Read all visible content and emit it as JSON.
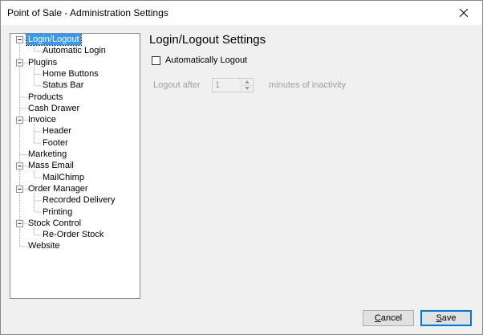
{
  "window": {
    "title": "Point of Sale - Administration Settings"
  },
  "tree": {
    "nodes": [
      {
        "label": "Login/Logout",
        "level": 0,
        "expander": "minus",
        "selected": true
      },
      {
        "label": "Automatic Login",
        "level": 1
      },
      {
        "label": "Plugins",
        "level": 0,
        "expander": "minus"
      },
      {
        "label": "Home Buttons",
        "level": 1
      },
      {
        "label": "Status Bar",
        "level": 1
      },
      {
        "label": "Products",
        "level": 0
      },
      {
        "label": "Cash Drawer",
        "level": 0
      },
      {
        "label": "Invoice",
        "level": 0,
        "expander": "minus"
      },
      {
        "label": "Header",
        "level": 1
      },
      {
        "label": "Footer",
        "level": 1
      },
      {
        "label": "Marketing",
        "level": 0
      },
      {
        "label": "Mass Email",
        "level": 0,
        "expander": "minus"
      },
      {
        "label": "MailChimp",
        "level": 1
      },
      {
        "label": "Order Manager",
        "level": 0,
        "expander": "minus"
      },
      {
        "label": "Recorded Delivery",
        "level": 1
      },
      {
        "label": "Printing",
        "level": 1
      },
      {
        "label": "Stock Control",
        "level": 0,
        "expander": "minus"
      },
      {
        "label": "Re-Order Stock",
        "level": 1
      },
      {
        "label": "Website",
        "level": 0
      }
    ]
  },
  "settings": {
    "heading": "Login/Logout Settings",
    "auto_logout_label": "Automatically Logout",
    "auto_logout_checked": false,
    "logout_after_label": "Logout after",
    "logout_after_value": "1",
    "minutes_label": "minutes of inactivity"
  },
  "buttons": {
    "cancel_label": "Cancel",
    "save_label": "Save"
  },
  "icons": {
    "close": "close-icon",
    "expander": "minus-box-icon",
    "spin_up": "spin-up-arrow-icon",
    "spin_down": "spin-down-arrow-icon"
  },
  "colors": {
    "selection": "#3399ff",
    "disabled_text": "#a0a0a0",
    "primary_border": "#0078d7"
  }
}
